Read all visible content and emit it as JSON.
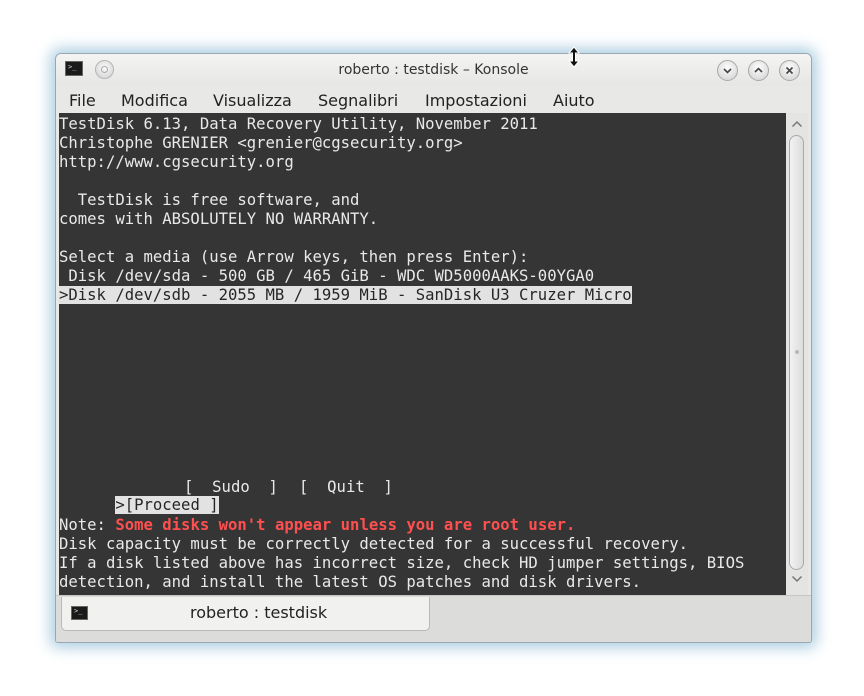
{
  "window": {
    "title": "roberto : testdisk – Konsole",
    "icons": [
      "terminal-icon",
      "pin-icon",
      "minimize-icon",
      "maximize-icon",
      "close-icon",
      "resize-cursor-icon"
    ]
  },
  "menu": {
    "items": [
      "File",
      "Modifica",
      "Visualizza",
      "Segnalibri",
      "Impostazioni",
      "Aiuto"
    ]
  },
  "terminal": {
    "header": [
      "TestDisk 6.13, Data Recovery Utility, November 2011",
      "Christophe GRENIER <grenier@cgsecurity.org>",
      "http://www.cgsecurity.org"
    ],
    "license": [
      "  TestDisk is free software, and",
      "comes with ABSOLUTELY NO WARRANTY."
    ],
    "prompt": "Select a media (use Arrow keys, then press Enter):",
    "disks": [
      " Disk /dev/sda - 500 GB / 465 GiB - WDC WD5000AAKS-00YGA0",
      ">Disk /dev/sdb - 2055 MB / 1959 MiB - SanDisk U3 Cruzer Micro"
    ],
    "selected_disk_index": 1,
    "actions": {
      "proceed": ">[Proceed ]",
      "sudo": "[  Sudo  ]",
      "quit": "[  Quit  ]"
    },
    "note_label": "Note: ",
    "note_warning": "Some disks won't appear unless you are root user.",
    "note_lines": [
      "Disk capacity must be correctly detected for a successful recovery.",
      "If a disk listed above has incorrect size, check HD jumper settings, BIOS",
      "detection, and install the latest OS patches and disk drivers."
    ]
  },
  "tabs": [
    {
      "label": "roberto : testdisk",
      "icon": "terminal-icon"
    }
  ],
  "colors": {
    "terminal_bg": "#353535",
    "terminal_fg": "#e9e9e9",
    "highlight_bg": "#e2e2e2",
    "warning": "#ff4f4f",
    "window_glow": "#5096be"
  }
}
